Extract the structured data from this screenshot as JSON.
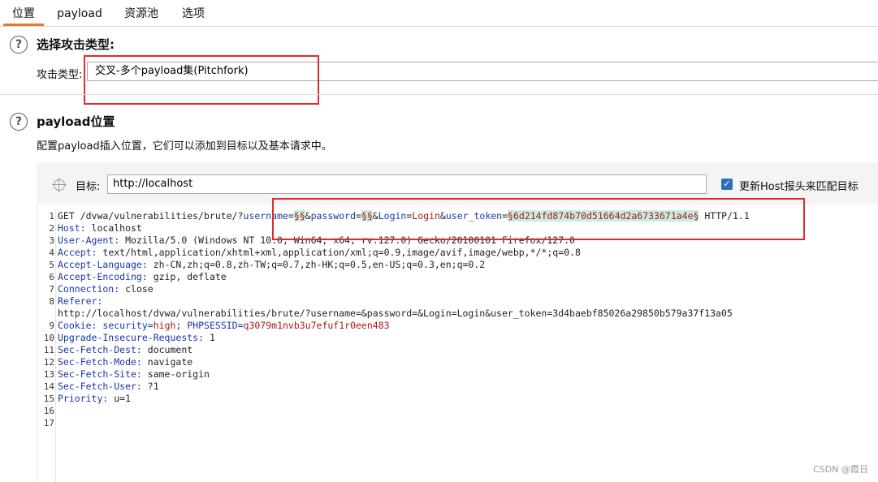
{
  "tabs": [
    {
      "label": "位置"
    },
    {
      "label": "payload"
    },
    {
      "label": "资源池"
    },
    {
      "label": "选项"
    }
  ],
  "attack_type": {
    "heading": "选择攻击类型:",
    "label": "攻击类型:",
    "selected": "交叉-多个payload集(Pitchfork)"
  },
  "positions": {
    "heading": "payload位置",
    "description": "配置payload插入位置，它们可以添加到目标以及基本请求中。",
    "target_label": "目标:",
    "target_value": "http://localhost",
    "checkbox_label": "更新Host报头来匹配目标"
  },
  "request": {
    "line1": {
      "prefix": "GET /dvwa/vulnerabilities/brute/?",
      "k1": "username",
      "eq1": "=",
      "m1": "§§",
      "amp1": "&",
      "k2": "password",
      "eq2": "=",
      "m2": "§§",
      "amp2": "&",
      "k3": "Login",
      "eq3": "=",
      "v3": "Login",
      "amp3": "&",
      "k4": "user_token",
      "eq4": "=",
      "m4": "§6d214fd874b70d51664d2a6733671a4e§",
      "suffix": " HTTP/1.1"
    },
    "line2": {
      "k": "Host:",
      "v": " localhost"
    },
    "line3": {
      "k": "User-Agent:",
      "v": " Mozilla/5.0 (Windows NT 10.0; Win64; x64; rv:127.0) Gecko/20100101 Firefox/127.0"
    },
    "line4": {
      "k": "Accept:",
      "v": " text/html,application/xhtml+xml,application/xml;q=0.9,image/avif,image/webp,*/*;q=0.8"
    },
    "line5": {
      "k": "Accept-Language:",
      "v": " zh-CN,zh;q=0.8,zh-TW;q=0.7,zh-HK;q=0.5,en-US;q=0.3,en;q=0.2"
    },
    "line6": {
      "k": "Accept-Encoding:",
      "v": " gzip, deflate"
    },
    "line7": {
      "k": "Connection:",
      "v": " close"
    },
    "line8": {
      "k": "Referer:",
      "v": ""
    },
    "line8b": "http://localhost/dvwa/vulnerabilities/brute/?username=&password=&Login=Login&user_token=3d4baebf85026a29850b579a37f13a05",
    "line9": {
      "k": "Cookie:",
      "k2": " security=",
      "v": "high",
      "sep": "; ",
      "k3": "PHPSESSID=",
      "v2": "q3079m1nvb3u7efuf1r0een483"
    },
    "line10": {
      "k": "Upgrade-Insecure-Requests:",
      "v": " 1"
    },
    "line11": {
      "k": "Sec-Fetch-Dest:",
      "v": " document"
    },
    "line12": {
      "k": "Sec-Fetch-Mode:",
      "v": " navigate"
    },
    "line13": {
      "k": "Sec-Fetch-Site:",
      "v": " same-origin"
    },
    "line14": {
      "k": "Sec-Fetch-User:",
      "v": " ?1"
    },
    "line15": {
      "k": "Priority:",
      "v": " u=1"
    }
  },
  "line_numbers": [
    "1",
    "2",
    "3",
    "4",
    "5",
    "6",
    "7",
    "8",
    "",
    "9",
    "10",
    "11",
    "12",
    "13",
    "14",
    "15",
    "16",
    "17"
  ],
  "watermark": "CSDN @霞日"
}
